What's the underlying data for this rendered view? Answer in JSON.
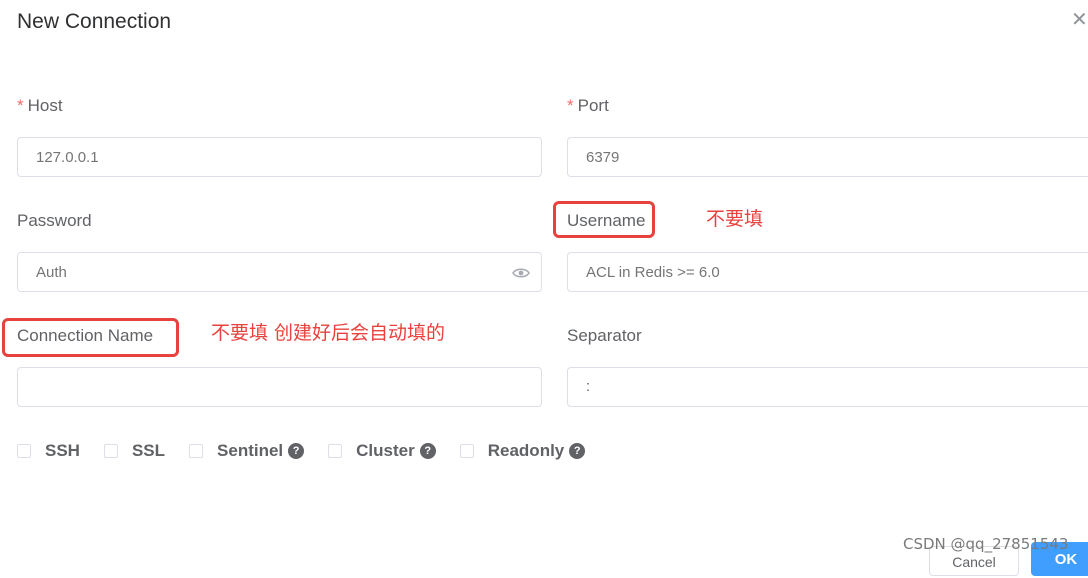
{
  "dialog": {
    "title": "New Connection",
    "close_icon": "close-icon"
  },
  "fields": {
    "host": {
      "required_mark": "*",
      "label": "Host",
      "placeholder": "127.0.0.1"
    },
    "port": {
      "required_mark": "*",
      "label": "Port",
      "placeholder": "6379"
    },
    "password": {
      "label": "Password",
      "placeholder": "Auth"
    },
    "username": {
      "label": "Username",
      "placeholder": "ACL in Redis >= 6.0"
    },
    "connection_name": {
      "label": "Connection Name",
      "value": ""
    },
    "separator": {
      "label": "Separator",
      "value": ":"
    }
  },
  "annotations": {
    "username_note": "不要填",
    "connection_name_note": "不要填 创建好后会自动填的"
  },
  "options": [
    {
      "label": "SSH",
      "checked": false,
      "help": false
    },
    {
      "label": "SSL",
      "checked": false,
      "help": false
    },
    {
      "label": "Sentinel",
      "checked": false,
      "help": true,
      "help_glyph": "?"
    },
    {
      "label": "Cluster",
      "checked": false,
      "help": true,
      "help_glyph": "?"
    },
    {
      "label": "Readonly",
      "checked": false,
      "help": true,
      "help_glyph": "?"
    }
  ],
  "footer": {
    "cancel_label": "Cancel",
    "ok_label": "OK"
  },
  "watermark": "CSDN @qq_27851543",
  "colors": {
    "required": "#f56c6c",
    "annotation": "#e8423f",
    "primary": "#409eff"
  }
}
